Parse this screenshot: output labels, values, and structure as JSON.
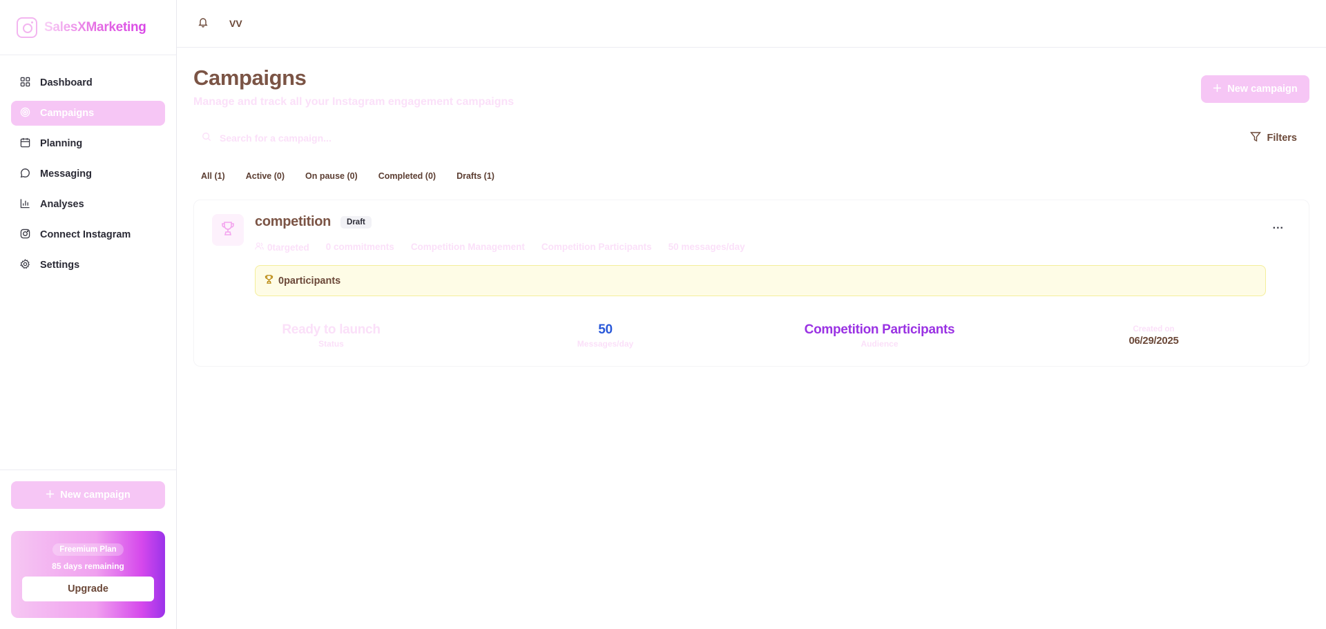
{
  "brand": {
    "name": "SalesXMarketing"
  },
  "sidebar": {
    "items": [
      {
        "label": "Dashboard",
        "icon": "grid-icon"
      },
      {
        "label": "Campaigns",
        "icon": "target-icon"
      },
      {
        "label": "Planning",
        "icon": "calendar-icon"
      },
      {
        "label": "Messaging",
        "icon": "chat-icon"
      },
      {
        "label": "Analyses",
        "icon": "bar-chart-icon"
      },
      {
        "label": "Connect Instagram",
        "icon": "instagram-icon"
      },
      {
        "label": "Settings",
        "icon": "gear-icon"
      }
    ],
    "active_index": 1,
    "new_campaign_label": "New campaign",
    "plan": {
      "badge": "Freemium Plan",
      "days_remaining": "85 days remaining",
      "upgrade_label": "Upgrade"
    }
  },
  "topbar": {
    "user_initials": "VV"
  },
  "page": {
    "title": "Campaigns",
    "subtitle": "Manage and track all your Instagram engagement campaigns",
    "new_campaign_label": "New campaign"
  },
  "search": {
    "placeholder": "Search for a campaign..."
  },
  "filters": {
    "label": "Filters"
  },
  "tabs": [
    {
      "label": "All (1)"
    },
    {
      "label": "Active (0)"
    },
    {
      "label": "On pause (0)"
    },
    {
      "label": "Completed (0)"
    },
    {
      "label": "Drafts (1)"
    }
  ],
  "campaign": {
    "title": "competition",
    "badge": "Draft",
    "more": "...",
    "meta": {
      "targeted": "0targeted",
      "commitments": "0 commitments",
      "type": "Competition Management",
      "audience": "Competition Participants",
      "rate": "50 messages/day"
    },
    "participants": "0participants",
    "stats": {
      "status_value": "Ready to launch",
      "status_label": "Status",
      "messages_value": "50",
      "messages_label": "Messages/day",
      "audience_value": "Competition Participants",
      "audience_label": "Audience",
      "created_label": "Created on",
      "created_value": "06/29/2025"
    }
  },
  "colors": {
    "accent": "#f6c6f5",
    "brand_gradient_end": "#9b33ea",
    "title": "#7b5445",
    "messages_value": "#2a59d9",
    "audience_value": "#9a32e3"
  }
}
